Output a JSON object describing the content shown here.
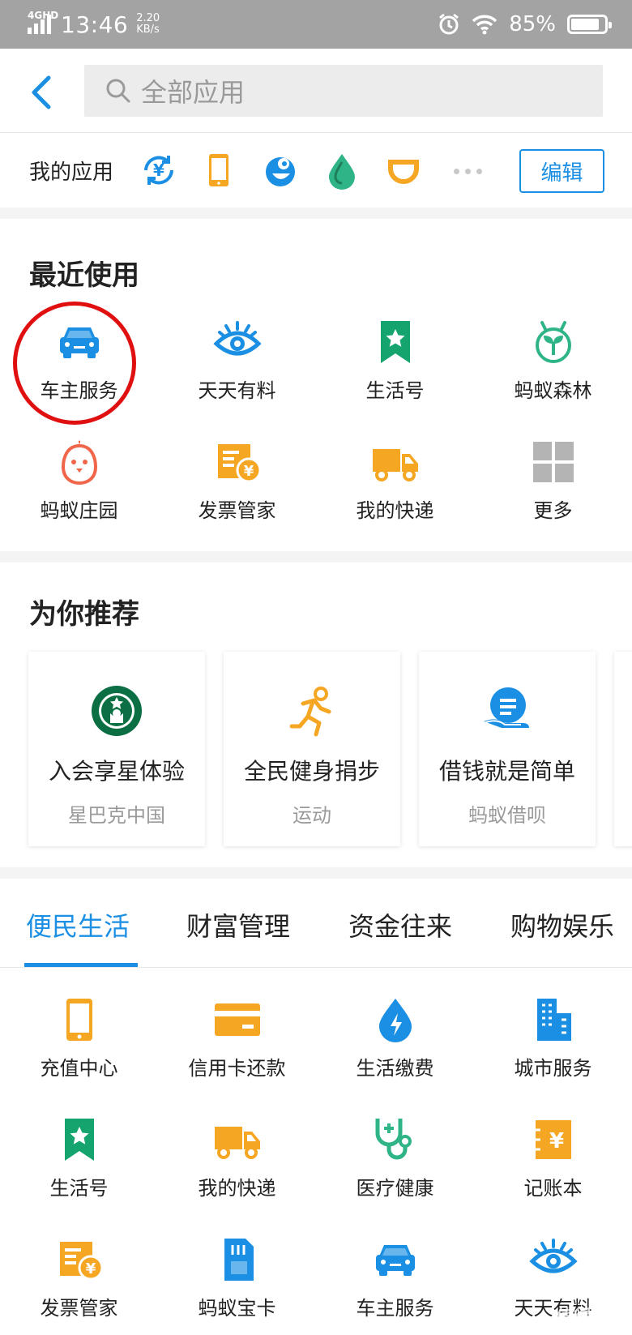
{
  "status": {
    "network": "4GHD",
    "time": "13:46",
    "speed": "2.20",
    "speed_unit": "KB/s",
    "battery": "85%"
  },
  "search": {
    "placeholder": "全部应用"
  },
  "my_apps": {
    "label": "我的应用",
    "edit": "编辑",
    "icons": [
      "yuan-exchange-icon",
      "phone-recharge-icon",
      "blue-bird-icon",
      "water-drop-icon",
      "didi-icon"
    ]
  },
  "recent": {
    "title": "最近使用",
    "items": [
      {
        "label": "车主服务",
        "icon": "car-icon",
        "color": "#1a8fe3"
      },
      {
        "label": "天天有料",
        "icon": "eye-icon",
        "color": "#1a8fe3"
      },
      {
        "label": "生活号",
        "icon": "bookmark-star-icon",
        "color": "#15a46e"
      },
      {
        "label": "蚂蚁森林",
        "icon": "sprout-icon",
        "color": "#2fb488"
      },
      {
        "label": "蚂蚁庄园",
        "icon": "chick-icon",
        "color": "#f0664a"
      },
      {
        "label": "发票管家",
        "icon": "invoice-icon",
        "color": "#f5a623"
      },
      {
        "label": "我的快递",
        "icon": "truck-icon",
        "color": "#f5a623"
      },
      {
        "label": "更多",
        "icon": "grid-more-icon",
        "color": "#b4b4b4"
      }
    ]
  },
  "recommend": {
    "title": "为你推荐",
    "cards": [
      {
        "title": "入会享星体验",
        "subtitle": "星巴克中国",
        "icon": "starbucks-logo-icon"
      },
      {
        "title": "全民健身捐步",
        "subtitle": "运动",
        "icon": "runner-icon"
      },
      {
        "title": "借钱就是简单",
        "subtitle": "蚂蚁借呗",
        "icon": "hand-coin-icon"
      }
    ]
  },
  "tabs": [
    "便民生活",
    "财富管理",
    "资金往来",
    "购物娱乐"
  ],
  "services": [
    {
      "label": "充值中心",
      "icon": "phone-recharge-icon"
    },
    {
      "label": "信用卡还款",
      "icon": "credit-card-icon"
    },
    {
      "label": "生活缴费",
      "icon": "bolt-drop-icon"
    },
    {
      "label": "城市服务",
      "icon": "buildings-icon"
    },
    {
      "label": "生活号",
      "icon": "bookmark-star-icon"
    },
    {
      "label": "我的快递",
      "icon": "truck-icon"
    },
    {
      "label": "医疗健康",
      "icon": "stethoscope-icon"
    },
    {
      "label": "记账本",
      "icon": "ledger-icon"
    },
    {
      "label": "发票管家",
      "icon": "invoice-icon"
    },
    {
      "label": "蚂蚁宝卡",
      "icon": "sim-card-icon"
    },
    {
      "label": "车主服务",
      "icon": "car-icon"
    },
    {
      "label": "天天有料",
      "icon": "eye-icon"
    }
  ],
  "watermark": "值得买"
}
